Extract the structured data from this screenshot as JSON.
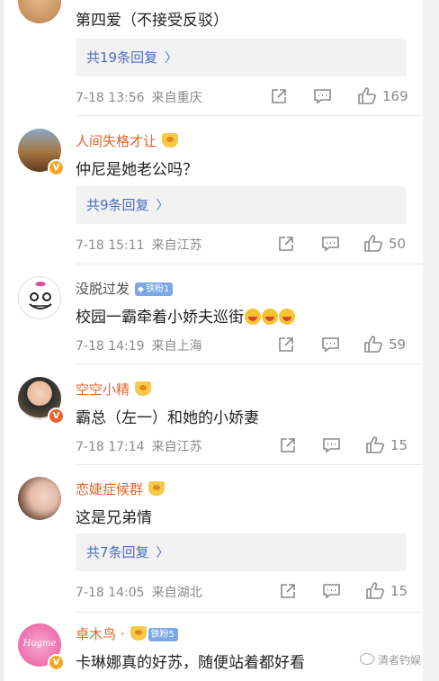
{
  "comments": [
    {
      "username": "",
      "text": "第四爱（不接受反驳）",
      "replies": "共19条回复",
      "time": "7-18 13:56",
      "location": "来自重庆",
      "likes": "169"
    },
    {
      "username": "人间失格才让",
      "text": "仲尼是她老公吗？",
      "replies": "共9条回复",
      "time": "7-18 15:11",
      "location": "来自江苏",
      "likes": "50"
    },
    {
      "username": "没脱过发",
      "badge": "铁粉1",
      "text": "校园一霸牵着小娇夫巡街",
      "time": "7-18 14:19",
      "location": "来自上海",
      "likes": "59"
    },
    {
      "username": "空空小精",
      "text": "霸总（左一）和她的小娇妻",
      "time": "7-18 17:14",
      "location": "来自江苏",
      "likes": "15"
    },
    {
      "username": "恋婕症候群",
      "text": "这是兄弟情",
      "replies": "共7条回复",
      "time": "7-18 14:05",
      "location": "来自湖北",
      "likes": "15"
    },
    {
      "username": "卓木鸟 ·",
      "badge": "铁粉5",
      "text": "卡琳娜真的好苏，随便站着都好看"
    }
  ],
  "avatar_text": "Hugme",
  "watermark": "清者钓娱",
  "colors": {
    "username_vip": "#e8632a",
    "reply_link": "#4a6fbe",
    "meta_gray": "#8a8a8a",
    "reply_bg": "#f2f2f2"
  }
}
